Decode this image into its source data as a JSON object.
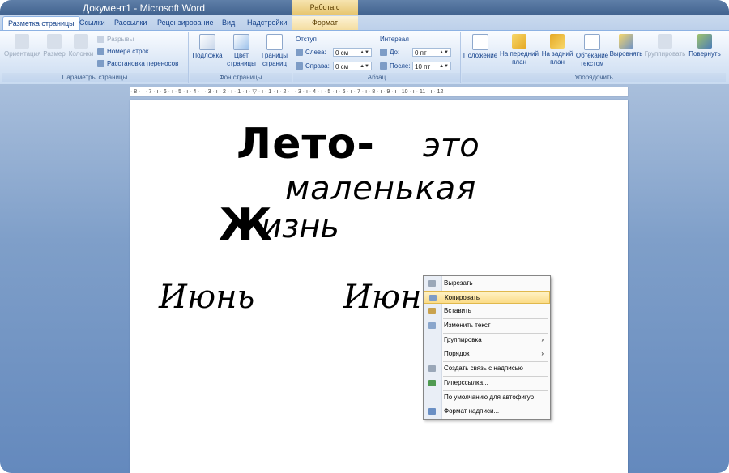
{
  "window": {
    "title": "Документ1 - Microsoft Word",
    "context_tab_title": "Работа с надписями"
  },
  "tabs": [
    "Разметка страницы",
    "Ссылки",
    "Рассылки",
    "Рецензирование",
    "Вид",
    "Надстройки",
    "Формат"
  ],
  "ribbon": {
    "page_setup": {
      "label": "Параметры страницы",
      "buttons": [
        "Ориентация",
        "Размер",
        "Колонки"
      ],
      "breaks": "Разрывы",
      "line_numbers": "Номера строк",
      "hyphenation": "Расстановка переносов"
    },
    "page_background": {
      "label": "Фон страницы",
      "watermark": "Подложка",
      "color_l1": "Цвет",
      "color_l2": "страницы",
      "borders_l1": "Границы",
      "borders_l2": "страниц"
    },
    "paragraph": {
      "label": "Абзац",
      "indent_head": "Отступ",
      "left_label": "Слева:",
      "left_value": "0 см",
      "right_label": "Справа:",
      "right_value": "0 см",
      "spacing_head": "Интервал",
      "before_label": "До:",
      "before_value": "0 пт",
      "after_label": "После:",
      "after_value": "10 пт"
    },
    "arrange": {
      "label": "Упорядочить",
      "position": "Положение",
      "front_l1": "На передний",
      "front_l2": "план",
      "back_l1": "На задний",
      "back_l2": "план",
      "wrap_l1": "Обтекание",
      "wrap_l2": "текстом",
      "align": "Выровнять",
      "group": "Группировать",
      "rotate": "Повернуть"
    }
  },
  "ruler": "· 8 · ı · 7 · ı · 6 · ı · 5 · ı · 4 · ı · 3 · ı · 2 · ı · 1 · ı · ▽ · ı · 1 · ı · 2 · ı · 3 · ı · 4 · ı · 5 · ı · 6 · ı · 7 · ı · 8 · ı · 9 · ı · 10 · ı · 11 · ı · 12",
  "document": {
    "wordart_line1_a": "Лето-",
    "wordart_line1_b": "это",
    "wordart_line2": "маленькая",
    "wordart_line3_a": "Ж",
    "wordart_line3_b": "изнь",
    "script_text_1": "Июнь",
    "script_text_2": "Июнь"
  },
  "context_menu": {
    "items": [
      {
        "label": "Вырезать",
        "icon": "scissors-icon"
      },
      {
        "label": "Копировать",
        "icon": "copy-icon",
        "highlighted": true
      },
      {
        "label": "Вставить",
        "icon": "paste-icon"
      },
      {
        "label": "Изменить текст",
        "icon": "edit-text-icon"
      },
      {
        "label": "Группировка",
        "submenu": true
      },
      {
        "label": "Порядок",
        "submenu": true
      },
      {
        "label": "Создать связь с надписью",
        "icon": "link-icon"
      },
      {
        "label": "Гиперссылка...",
        "icon": "hyperlink-icon"
      },
      {
        "label": "По умолчанию для автофигур"
      },
      {
        "label": "Формат надписи...",
        "icon": "format-icon"
      }
    ],
    "submenu_arrow": "›"
  },
  "colors": {
    "title_bar": "#4a6a99",
    "ribbon_text": "#15428b",
    "menu_highlight": "#fbdc88",
    "doc_background": "#7f9fc9"
  }
}
